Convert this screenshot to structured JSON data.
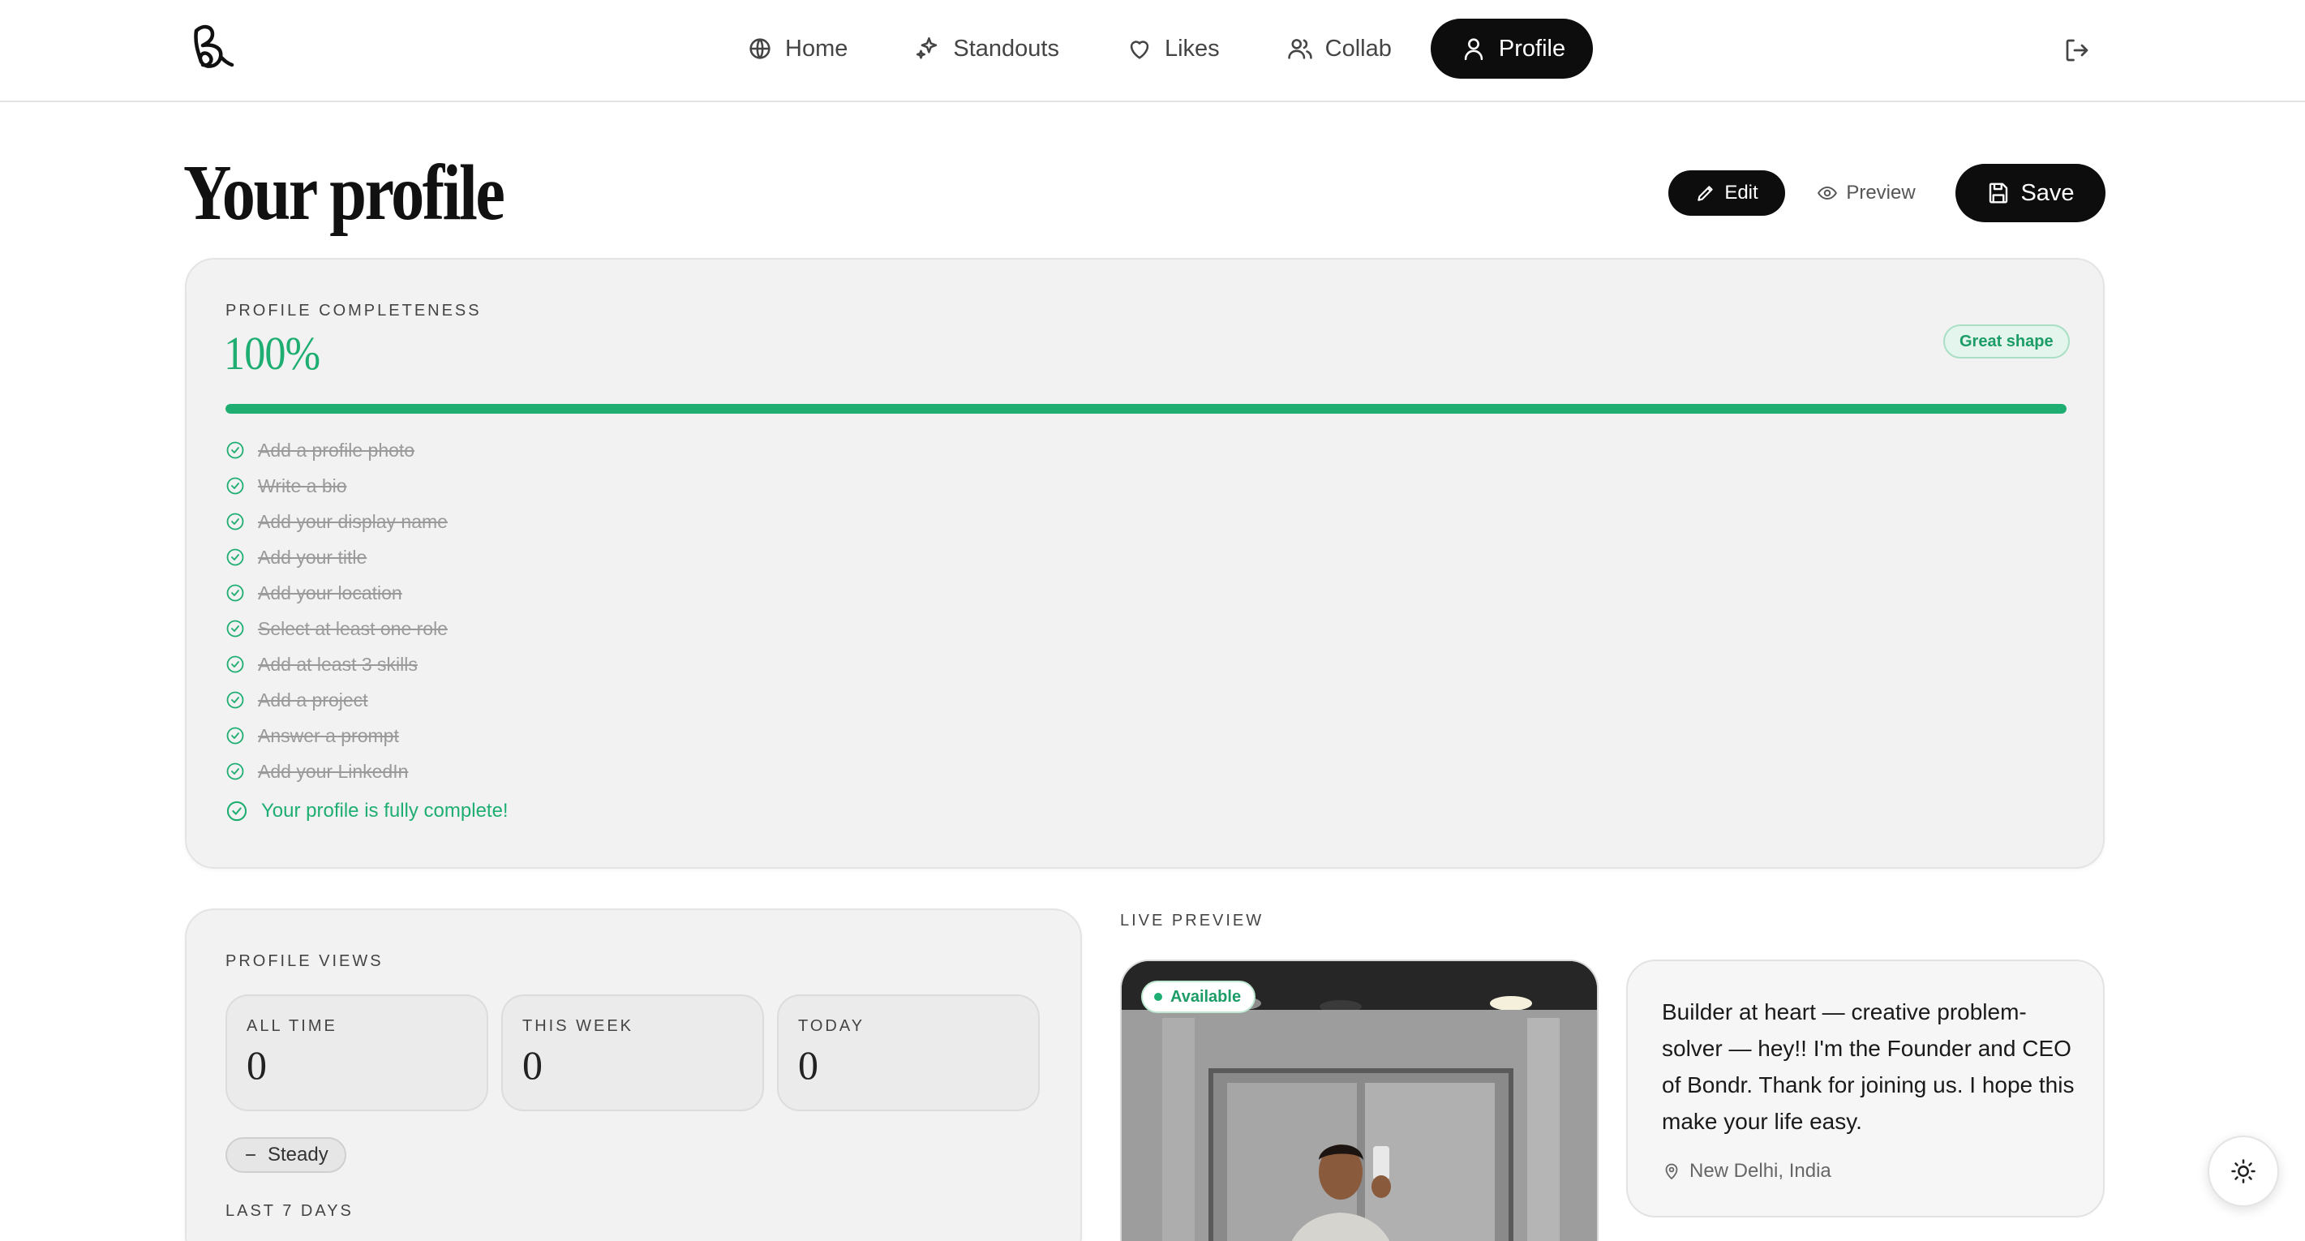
{
  "nav": {
    "items": [
      {
        "label": "Home",
        "icon": "home-icon"
      },
      {
        "label": "Standouts",
        "icon": "sparkles-icon"
      },
      {
        "label": "Likes",
        "icon": "heart-icon"
      },
      {
        "label": "Collab",
        "icon": "users-icon"
      },
      {
        "label": "Profile",
        "icon": "user-icon",
        "active": true
      }
    ]
  },
  "page": {
    "title": "Your profile",
    "edit_label": "Edit",
    "preview_label": "Preview",
    "save_label": "Save"
  },
  "completeness": {
    "eyebrow": "PROFILE COMPLETENESS",
    "percent_label": "100%",
    "progress_fraction": 1.0,
    "badge": "Great shape",
    "checklist": [
      "Add a profile photo",
      "Write a bio",
      "Add your display name",
      "Add your title",
      "Add your location",
      "Select at least one role",
      "Add at least 3 skills",
      "Add a project",
      "Answer a prompt",
      "Add your LinkedIn"
    ],
    "complete_message": "Your profile is fully complete!"
  },
  "views": {
    "eyebrow": "PROFILE VIEWS",
    "stats": [
      {
        "label": "ALL TIME",
        "value": "0"
      },
      {
        "label": "THIS WEEK",
        "value": "0"
      },
      {
        "label": "TODAY",
        "value": "0"
      }
    ],
    "trend": "Steady",
    "last7_label": "LAST 7 DAYS"
  },
  "preview": {
    "eyebrow": "LIVE PREVIEW",
    "status": "Available",
    "bio": "Builder at heart — creative problem-solver — hey!! I'm the Founder and CEO of Bondr. Thank for joining us. I hope this make your life easy.",
    "location": "New Delhi, India"
  },
  "colors": {
    "accent": "#1fae72",
    "dark": "#0d0d0d",
    "card_bg": "#f2f2f2"
  }
}
